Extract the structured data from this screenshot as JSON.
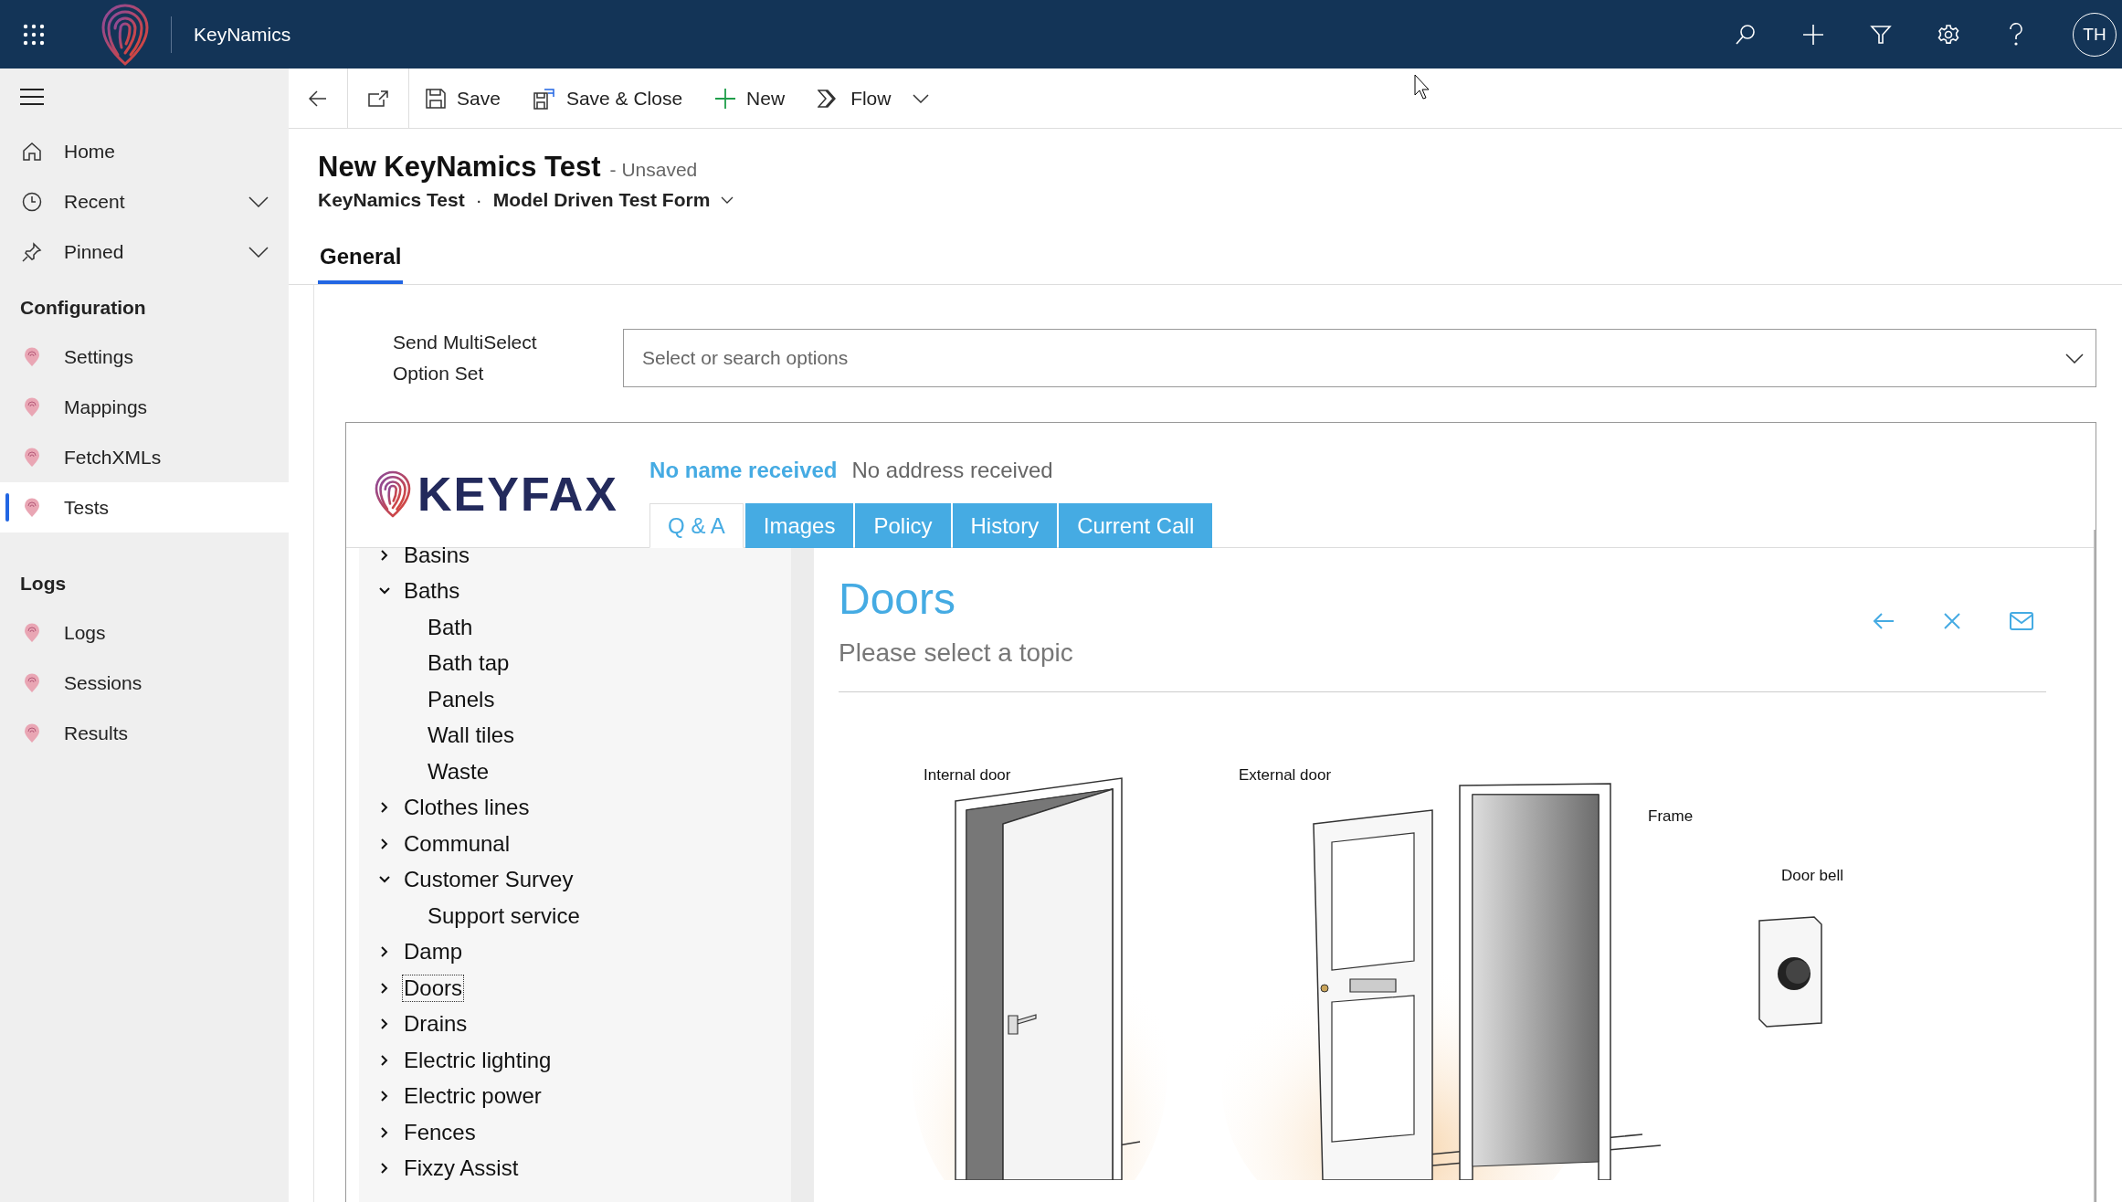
{
  "app": {
    "name": "KeyNamics",
    "user_initials": "TH"
  },
  "sidebar": {
    "sections": [
      {
        "items": [
          {
            "label": "Home",
            "kind": "home",
            "expandable": false,
            "selected": false
          },
          {
            "label": "Recent",
            "kind": "recent",
            "expandable": true,
            "selected": false
          },
          {
            "label": "Pinned",
            "kind": "pinned",
            "expandable": true,
            "selected": false
          }
        ]
      },
      {
        "heading": "Configuration",
        "items": [
          {
            "label": "Settings",
            "kind": "entity",
            "expandable": false,
            "selected": false
          },
          {
            "label": "Mappings",
            "kind": "entity",
            "expandable": false,
            "selected": false
          },
          {
            "label": "FetchXMLs",
            "kind": "entity",
            "expandable": false,
            "selected": false
          },
          {
            "label": "Tests",
            "kind": "entity",
            "expandable": false,
            "selected": true
          }
        ]
      },
      {
        "heading": "Logs",
        "items": [
          {
            "label": "Logs",
            "kind": "entity",
            "expandable": false,
            "selected": false
          },
          {
            "label": "Sessions",
            "kind": "entity",
            "expandable": false,
            "selected": false
          },
          {
            "label": "Results",
            "kind": "entity",
            "expandable": false,
            "selected": false
          }
        ]
      }
    ]
  },
  "commands": [
    {
      "label": "Save",
      "kind": "save"
    },
    {
      "label": "Save & Close",
      "kind": "save-close"
    },
    {
      "label": "New",
      "kind": "new"
    },
    {
      "label": "Flow",
      "kind": "flow"
    }
  ],
  "record": {
    "title": "New KeyNamics Test",
    "status": "- Unsaved",
    "entity": "KeyNamics Test",
    "separator": "·",
    "form": "Model Driven Test Form"
  },
  "form_tabs": [
    {
      "label": "General",
      "selected": true
    }
  ],
  "field": {
    "label": "Send MultiSelect Option Set",
    "placeholder": "Select or search options"
  },
  "keyfax": {
    "brand": "KEYFAX",
    "contact_name": "No name received",
    "contact_address": "No address received",
    "tabs": [
      {
        "label": "Q & A",
        "selected": true
      },
      {
        "label": "Images",
        "selected": false
      },
      {
        "label": "Policy",
        "selected": false
      },
      {
        "label": "History",
        "selected": false
      },
      {
        "label": "Current Call",
        "selected": false
      }
    ],
    "tree": [
      {
        "label": "Basins",
        "kind": "group",
        "expanded": false,
        "selected": false
      },
      {
        "label": "Baths",
        "kind": "group",
        "expanded": true,
        "selected": false,
        "children": [
          {
            "label": "Bath",
            "kind": "topic",
            "selected": false
          },
          {
            "label": "Bath tap",
            "kind": "topic",
            "selected": false
          },
          {
            "label": "Panels",
            "kind": "topic",
            "selected": false
          },
          {
            "label": "Wall tiles",
            "kind": "topic",
            "selected": false
          },
          {
            "label": "Waste",
            "kind": "topic",
            "selected": false
          }
        ]
      },
      {
        "label": "Clothes lines",
        "kind": "group",
        "expanded": false,
        "selected": false
      },
      {
        "label": "Communal",
        "kind": "group",
        "expanded": false,
        "selected": false
      },
      {
        "label": "Customer Survey",
        "kind": "group",
        "expanded": true,
        "selected": false,
        "children": [
          {
            "label": "Support service",
            "kind": "topic",
            "selected": false
          }
        ]
      },
      {
        "label": "Damp",
        "kind": "group",
        "expanded": false,
        "selected": false
      },
      {
        "label": "Doors",
        "kind": "group",
        "expanded": false,
        "selected": true
      },
      {
        "label": "Drains",
        "kind": "group",
        "expanded": false,
        "selected": false
      },
      {
        "label": "Electric lighting",
        "kind": "group",
        "expanded": false,
        "selected": false
      },
      {
        "label": "Electric power",
        "kind": "group",
        "expanded": false,
        "selected": false
      },
      {
        "label": "Fences",
        "kind": "group",
        "expanded": false,
        "selected": false
      },
      {
        "label": "Fixzy Assist",
        "kind": "group",
        "expanded": false,
        "selected": false
      }
    ],
    "topic": {
      "title": "Doors",
      "prompt": "Please select a topic"
    },
    "illustrations": [
      {
        "label": "Internal door",
        "kind": "internal-door"
      },
      {
        "label": "External door",
        "kind": "external-door"
      },
      {
        "label": "Frame",
        "kind": "frame"
      },
      {
        "label": "Door bell",
        "kind": "door-bell"
      }
    ]
  }
}
